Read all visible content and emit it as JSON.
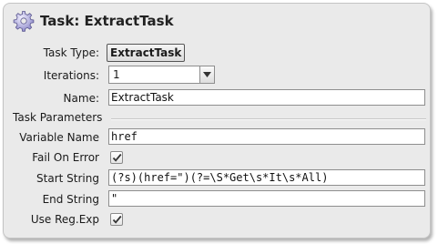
{
  "header": {
    "title": "Task: ExtractTask",
    "icon": "gear-icon"
  },
  "form": {
    "task_type_label": "Task Type:",
    "task_type_value": "ExtractTask",
    "iterations_label": "Iterations:",
    "iterations_value": "1",
    "name_label": "Name:",
    "name_value": "ExtractTask",
    "section_title": "Task Parameters",
    "variable_name_label": "Variable Name",
    "variable_name_value": "href",
    "fail_on_error_label": "Fail On Error",
    "fail_on_error_checked": true,
    "start_string_label": "Start String",
    "start_string_value": "(?s)(href=\")(?=\\S*Get\\s*It\\s*All)",
    "end_string_label": "End String",
    "end_string_value": "\"",
    "use_regexp_label": "Use Reg.Exp",
    "use_regexp_checked": true
  }
}
